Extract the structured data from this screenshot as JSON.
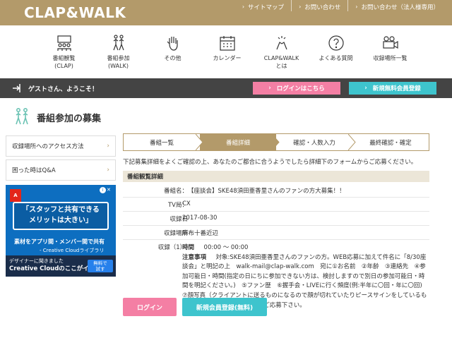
{
  "brand": {
    "logo_text": "CLAP&WALK",
    "accent_color": "#b39a6a"
  },
  "top_links": [
    {
      "label": "サイトマップ"
    },
    {
      "label": "お問い合わせ"
    },
    {
      "label": "お問い合わせ（法人様専用）"
    }
  ],
  "nav": [
    {
      "label": "番組観覧\n(CLAP)",
      "icon": "audience-icon"
    },
    {
      "label": "番組参加\n(WALK)",
      "icon": "walking-people-icon"
    },
    {
      "label": "その他",
      "icon": "hand-icon"
    },
    {
      "label": "カレンダー",
      "icon": "calendar-icon"
    },
    {
      "label": "CLAP&WALK\nとは",
      "icon": "clap-icon"
    },
    {
      "label": "よくある質問",
      "icon": "question-icon"
    },
    {
      "label": "収録場所一覧",
      "icon": "camera-icon"
    }
  ],
  "guest_bar": {
    "greeting": "ゲストさん、ようこそ！",
    "login_label": "ログインはこちら",
    "register_label": "新規無料会員登録"
  },
  "page_title": "番組参加の募集",
  "sidebar": {
    "links": [
      {
        "label": "収録場所へのアクセス方法"
      },
      {
        "label": "困った時はQ&A"
      }
    ]
  },
  "ad": {
    "brand": "Adobe",
    "headline_line1": "「スタッフと共有できる",
    "headline_line2": "メリットは大きい」",
    "sub": "素材をアプリ間・メンバー間で共有",
    "sub2": "- Creative Cloudライブラリ",
    "footer_line1": "デザイナーに聞きました",
    "footer_line2": "Creative Cloudのここがイイ!",
    "button": "無料で\n試す"
  },
  "steps": [
    {
      "label": "番組一覧",
      "active": false
    },
    {
      "label": "番組詳細",
      "active": true
    },
    {
      "label": "確認・人数入力",
      "active": false
    },
    {
      "label": "最終確認・確定",
      "active": false
    }
  ],
  "intro": "下記募集詳細をよくご確認の上、あなたのご都合に合うようでしたら詳細下のフォームからご応募ください。",
  "section_head": "番組観覧詳細",
  "details": {
    "program_label": "番組名：",
    "program_value": "【座談会】SKE48須田亜香里さんのファンの方大募集！！",
    "tv_label": "TV局：",
    "tv_value": "CX",
    "date_label": "収録日",
    "date_value": "2017-08-30",
    "place_label": "収録場所",
    "place_value": "麻布十番近辺",
    "rec_label": "収録（1）:",
    "time_label": "時間",
    "time_value": "00:00 〜 00:00",
    "notes_label": "注意事項",
    "notes_text": "対象:SKE48須田亜香里さんのファンの方。WEB応募に加えて件名に「8/30座談会」と明記の上　walk-mail@clap-walk.com　宛に①お名前　②年齢　③連絡先　④参加可能日・時間(指定の日にちに参加できない方は、検討しますので別日の参加可能日・時間を明記ください。)　⑤ファン歴　⑥握手会・LIVEに行く頻度(例:半年に〇回・年に〇回)　⑦顔写真（クライアントに送るものになるので顔が切れていたりピースサインをしているものはNGです。）1枚を送付の上ご応募下さい。"
  },
  "actions": {
    "login_label": "ログイン",
    "register_label": "新規会員登録(無料)"
  }
}
